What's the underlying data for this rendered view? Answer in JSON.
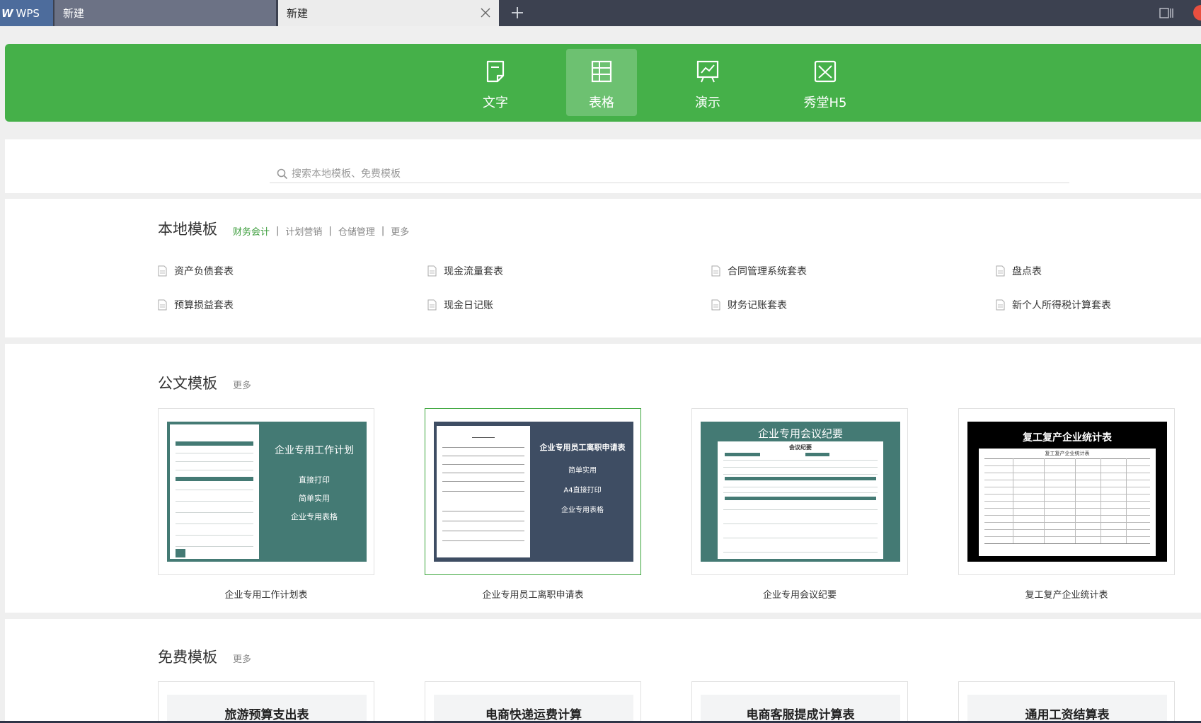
{
  "tabs": {
    "app_name": "WPS",
    "tab1_label": "新建",
    "tab2_label": "新建"
  },
  "categories": [
    {
      "label": "文字",
      "icon": "document-icon"
    },
    {
      "label": "表格",
      "icon": "spreadsheet-icon",
      "active": true
    },
    {
      "label": "演示",
      "icon": "presentation-icon"
    },
    {
      "label": "秀堂H5",
      "icon": "h5-icon"
    }
  ],
  "search": {
    "placeholder": "搜索本地模板、免费模板"
  },
  "local": {
    "title": "本地模板",
    "links": [
      "财务会计",
      "计划营销",
      "仓储管理",
      "更多"
    ],
    "files": [
      "资产负债套表",
      "现金流量套表",
      "合同管理系统套表",
      "盘点表",
      "预算损益套表",
      "现金日记账",
      "财务记账套表",
      "新个人所得税计算套表"
    ]
  },
  "official": {
    "title": "公文模板",
    "more": "更多",
    "cards": [
      {
        "label": "企业专用工作计划表",
        "thumb_title": "企业专用工作计划",
        "thumb_lines": [
          "直接打印",
          "简单实用",
          "企业专用表格"
        ]
      },
      {
        "label": "企业专用员工离职申请表",
        "thumb_title": "企业专用员工离职申请表",
        "thumb_lines": [
          "简单实用",
          "A4直接打印",
          "企业专用表格"
        ]
      },
      {
        "label": "企业专用会议纪要",
        "thumb_title": "企业专用会议纪要",
        "thumb_sub": "会议纪要"
      },
      {
        "label": "复工复产企业统计表",
        "thumb_title": "复工复产企业统计表",
        "thumb_sub": "复工复产企业统计表"
      }
    ]
  },
  "free": {
    "title": "免费模板",
    "more": "更多",
    "cards": [
      "旅游预算支出表",
      "电商快递运费计算",
      "电商客服提成计算表",
      "通用工资结算表"
    ]
  },
  "colors": {
    "green": "#45b049",
    "teal": "#447a74",
    "slate": "#3e4d63",
    "selected_border": "#3aa53a"
  }
}
